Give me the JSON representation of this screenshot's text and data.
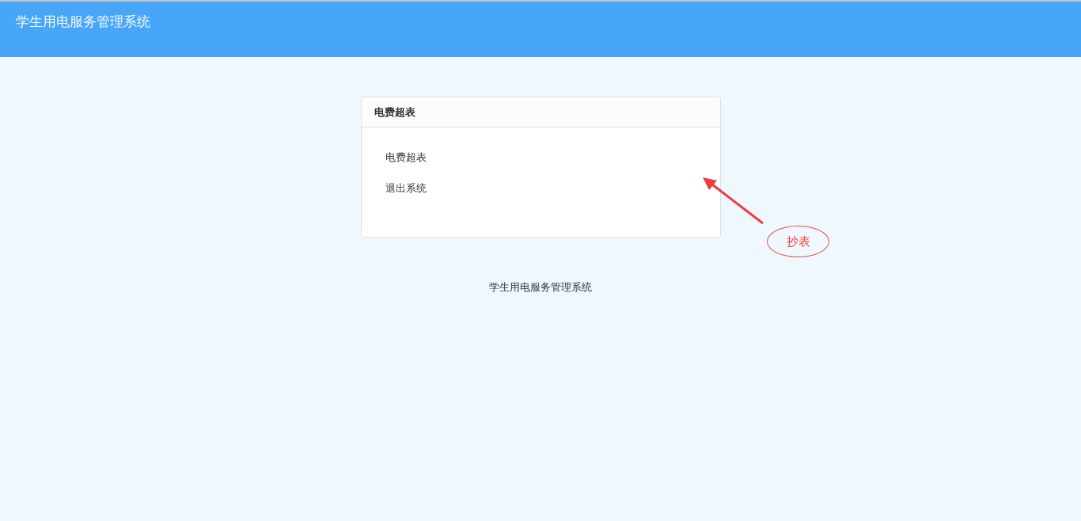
{
  "header": {
    "title": "学生用电服务管理系统"
  },
  "panel": {
    "title": "电费超表",
    "links": [
      "电费超表",
      "退出系统"
    ]
  },
  "annotation": {
    "label": "抄表"
  },
  "footer": {
    "text": "学生用电服务管理系统"
  }
}
